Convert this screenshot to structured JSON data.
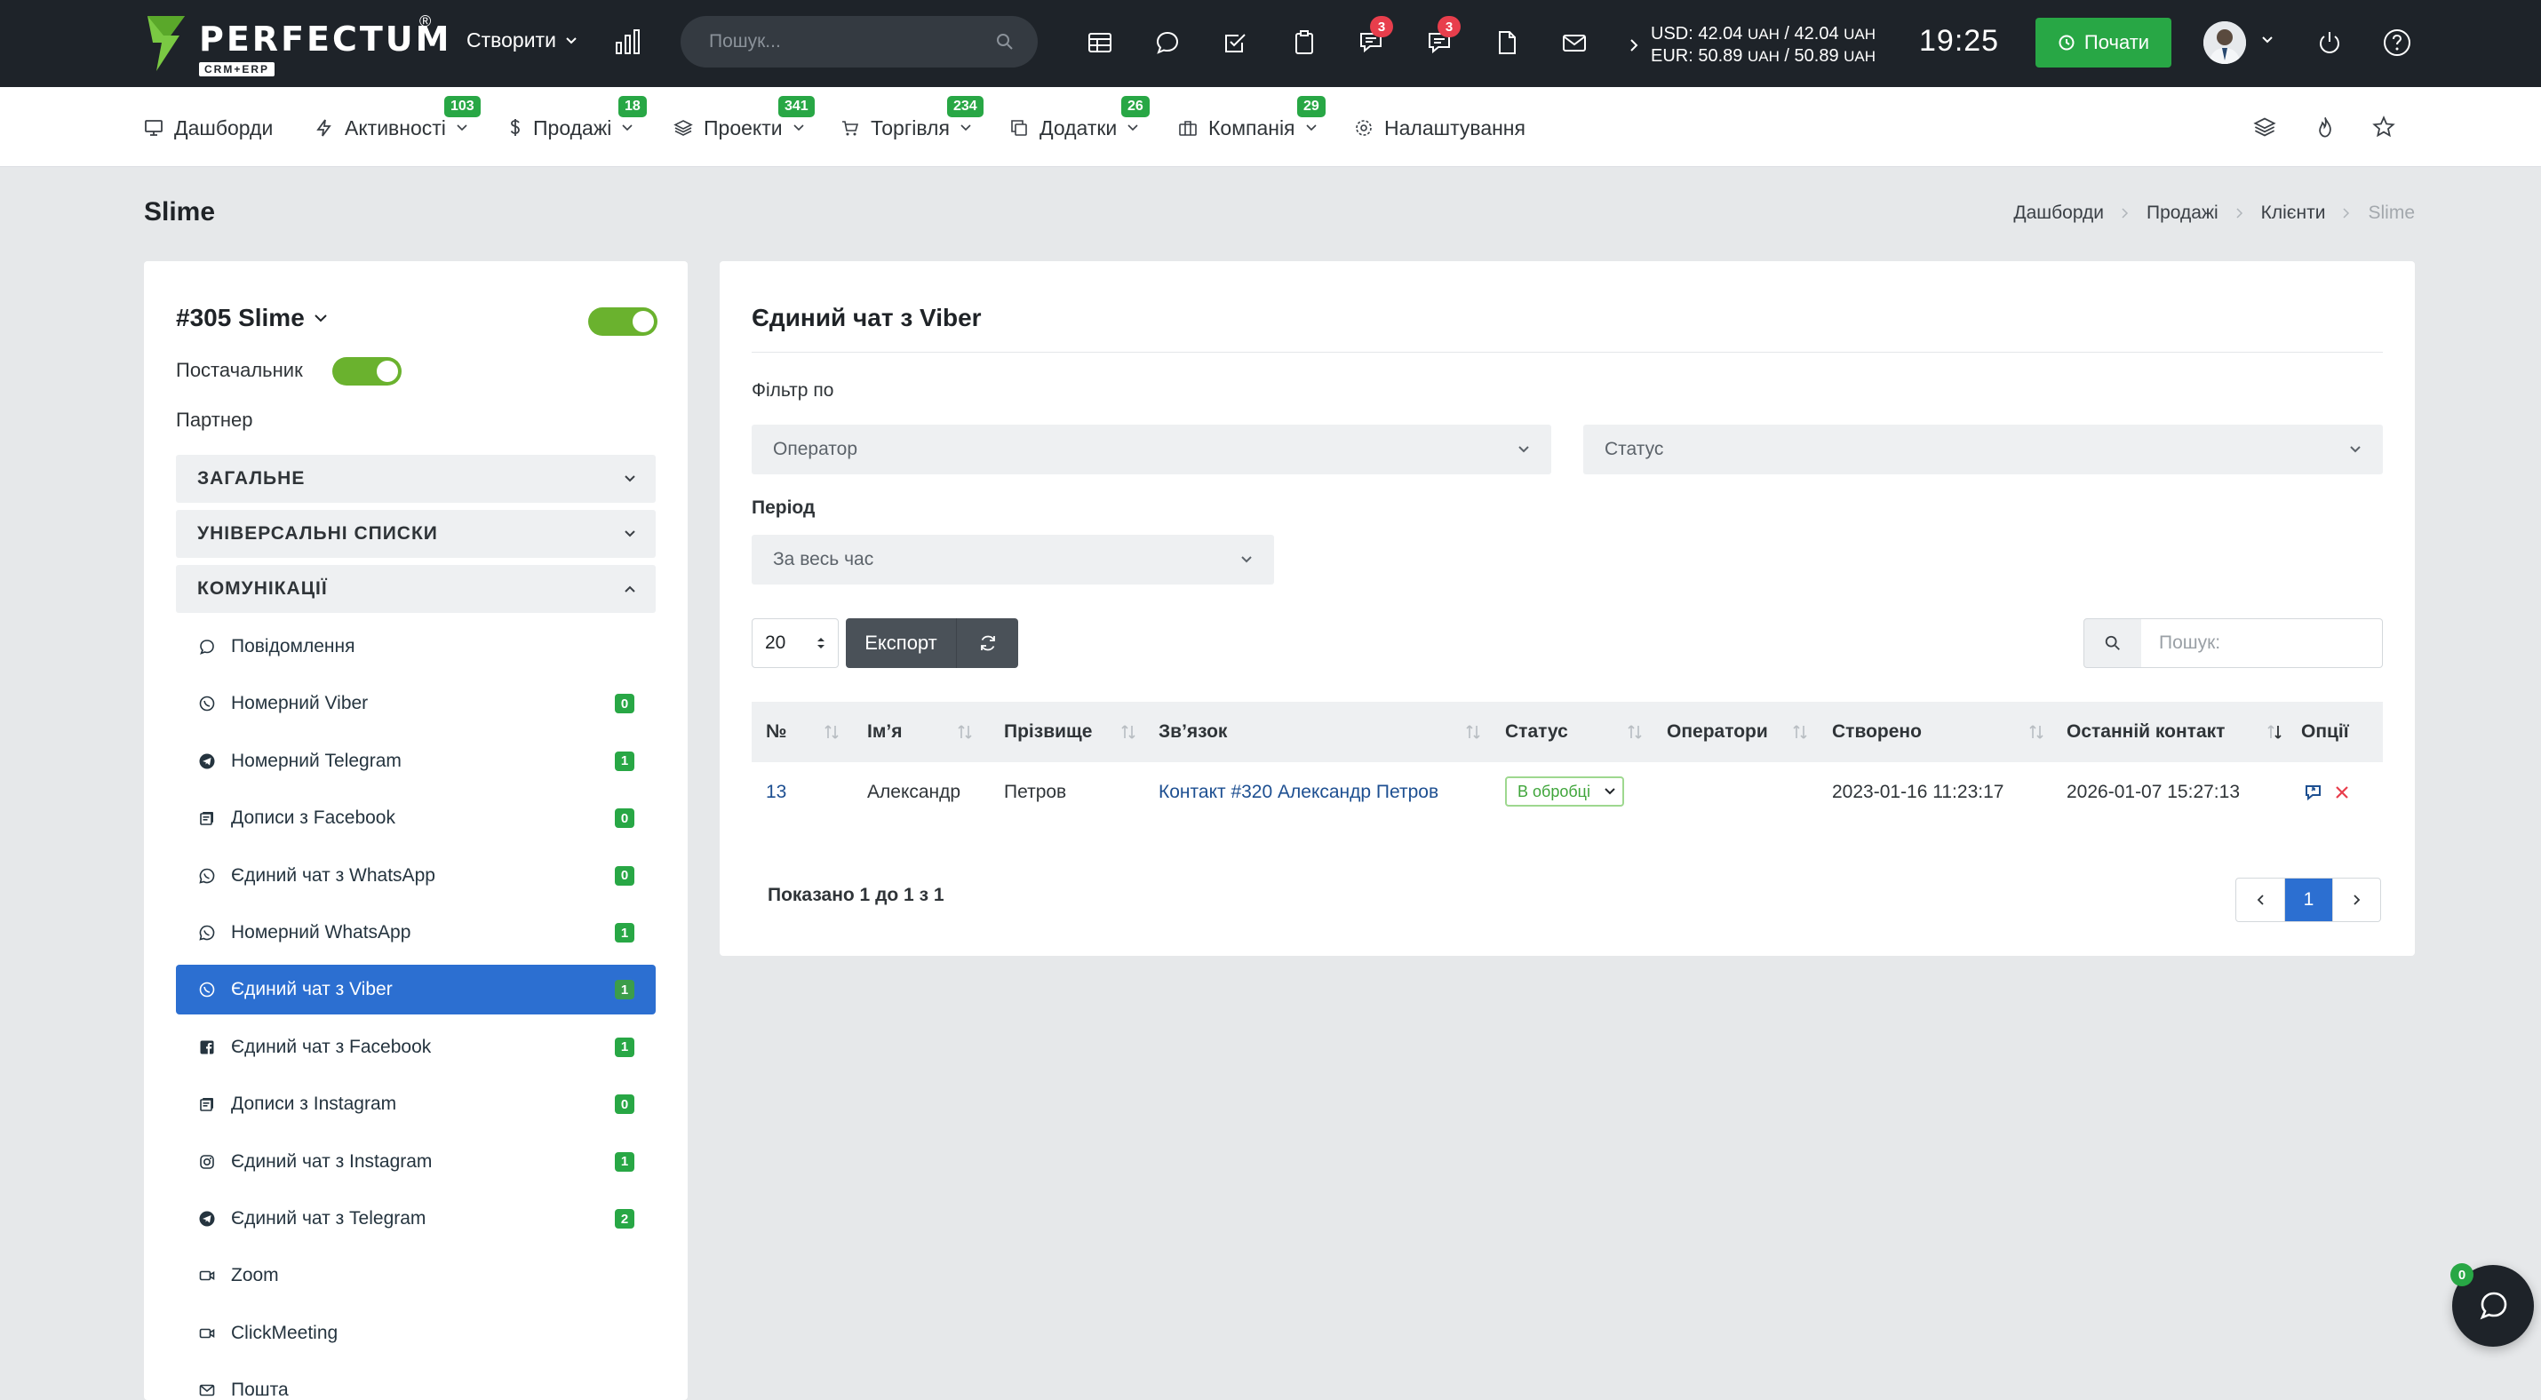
{
  "app": {
    "brand": "PERFECTUM",
    "brand_mark": "®",
    "brand_sub": "CRM+ERP"
  },
  "topbar": {
    "create_label": "Створити",
    "search_placeholder": "Пошук...",
    "badges": {
      "chat": "3",
      "messages": "3"
    },
    "rates": {
      "usd_label": "USD: 42.04",
      "usd_unit1": "UAH",
      "usd_mid": " / 42.04",
      "usd_unit2": "UAH",
      "eur_label": "EUR: 50.89",
      "eur_unit1": "UAH",
      "eur_mid": " / 50.89",
      "eur_unit2": "UAH"
    },
    "clock": "19:25",
    "start_label": "Почати"
  },
  "nav": {
    "items": [
      {
        "label": "Дашборди",
        "badge": ""
      },
      {
        "label": "Активності",
        "badge": "103"
      },
      {
        "label": "Продажі",
        "badge": "18"
      },
      {
        "label": "Проекти",
        "badge": "341"
      },
      {
        "label": "Торгівля",
        "badge": "234"
      },
      {
        "label": "Додатки",
        "badge": "26"
      },
      {
        "label": "Компанія",
        "badge": "29"
      },
      {
        "label": "Налаштування",
        "badge": ""
      }
    ]
  },
  "page": {
    "title": "Slime",
    "breadcrumb": [
      "Дашборди",
      "Продажі",
      "Клієнти",
      "Slime"
    ]
  },
  "client": {
    "title": "#305 Slime",
    "supplier_label": "Постачальник",
    "partner_label": "Партнер",
    "sections": [
      "ЗАГАЛЬНЕ",
      "УНІВЕРСАЛЬНІ СПИСКИ",
      "КОМУНІКАЦІЇ"
    ],
    "menu": [
      {
        "label": "Повідомлення",
        "badge": "",
        "icon": "message-icon"
      },
      {
        "label": "Номерний Viber",
        "badge": "0",
        "icon": "viber-icon"
      },
      {
        "label": "Номерний Telegram",
        "badge": "1",
        "icon": "telegram-icon"
      },
      {
        "label": "Дописи з Facebook",
        "badge": "0",
        "icon": "posts-icon"
      },
      {
        "label": "Єдиний чат з WhatsApp",
        "badge": "0",
        "icon": "whatsapp-icon"
      },
      {
        "label": "Номерний WhatsApp",
        "badge": "1",
        "icon": "whatsapp-icon"
      },
      {
        "label": "Єдиний чат з Viber",
        "badge": "1",
        "icon": "viber-icon"
      },
      {
        "label": "Єдиний чат з Facebook",
        "badge": "1",
        "icon": "facebook-icon"
      },
      {
        "label": "Дописи з Instagram",
        "badge": "0",
        "icon": "posts-icon"
      },
      {
        "label": "Єдиний чат з Instagram",
        "badge": "1",
        "icon": "instagram-icon"
      },
      {
        "label": "Єдиний чат з Telegram",
        "badge": "2",
        "icon": "telegram-icon"
      },
      {
        "label": "Zoom",
        "badge": "",
        "icon": "video-icon"
      },
      {
        "label": "ClickMeeting",
        "badge": "",
        "icon": "video-icon"
      },
      {
        "label": "Пошта",
        "badge": "",
        "icon": "mail-icon"
      }
    ]
  },
  "main": {
    "title": "Єдиний чат з Viber",
    "filter_label": "Фільтр по",
    "operator_select": "Оператор",
    "status_select": "Статус",
    "period_label": "Період",
    "period_select": "За весь час",
    "page_size": "20",
    "export_label": "Експорт",
    "search_placeholder": "Пошук:",
    "columns": [
      "№",
      "Ім’я",
      "Прізвище",
      "Зв’язок",
      "Статус",
      "Оператори",
      "Створено",
      "Останній контакт",
      "Опції"
    ],
    "rows": [
      {
        "num": "13",
        "first_name": "Александр",
        "last_name": "Петров",
        "contact": "Контакт #320 Александр Петров",
        "status": "В обробці",
        "operators": "",
        "created": "2023-01-16 11:23:17",
        "last_contact": "2026-01-07 15:27:13"
      }
    ],
    "shown_text": "Показано 1 до 1 з 1",
    "current_page": "1"
  },
  "chat_widget": {
    "badge": "0"
  },
  "colors": {
    "topbar": "#1e2329",
    "accent": "#2c6fd1",
    "success": "#28a745",
    "danger": "#e83e4c"
  }
}
